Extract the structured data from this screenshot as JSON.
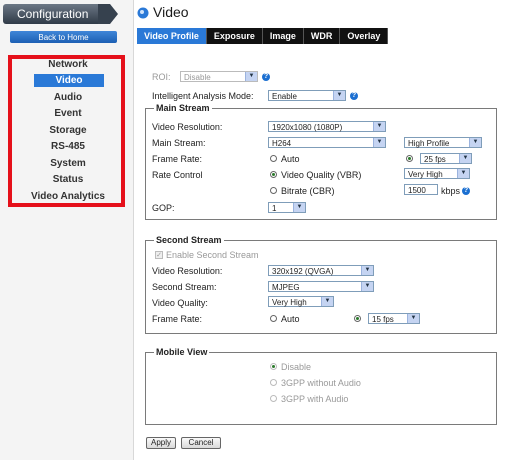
{
  "sidebar": {
    "config_label": "Configuration",
    "back_label": "Back to Home",
    "items": [
      "Network",
      "Video",
      "Audio",
      "Event",
      "Storage",
      "RS-485",
      "System",
      "Status",
      "Video Analytics"
    ],
    "active": "Video"
  },
  "header": {
    "title": "Video"
  },
  "tabs": [
    "Video Profile",
    "Exposure",
    "Image",
    "WDR",
    "Overlay"
  ],
  "form": {
    "roi_label": "ROI:",
    "roi_value": "Disable",
    "iam_label": "Intelligent Analysis Mode:",
    "iam_value": "Enable",
    "main": {
      "legend": "Main Stream",
      "resolution_label": "Video Resolution:",
      "resolution_value": "1920x1080 (1080P)",
      "stream_label": "Main Stream:",
      "stream_value": "H264",
      "profile_value": "High Profile",
      "framerate_label": "Frame Rate:",
      "auto_label": "Auto",
      "fps_value": "25 fps",
      "ratecontrol_label": "Rate Control",
      "vq_label": "Video Quality (VBR)",
      "vq_value": "Very High",
      "bitrate_label": "Bitrate (CBR)",
      "bitrate_value": "1500",
      "kbps_label": "kbps",
      "gop_label": "GOP:",
      "gop_value": "1"
    },
    "second": {
      "legend": "Second Stream",
      "enable_label": "Enable Second Stream",
      "resolution_label": "Video Resolution:",
      "resolution_value": "320x192 (QVGA)",
      "stream_label": "Second Stream:",
      "stream_value": "MJPEG",
      "quality_label": "Video Quality:",
      "quality_value": "Very High",
      "framerate_label": "Frame Rate:",
      "auto_label": "Auto",
      "fps_value": "15 fps"
    },
    "mobile": {
      "legend": "Mobile View",
      "options": [
        "Disable",
        "3GPP without Audio",
        "3GPP with Audio"
      ]
    },
    "apply_label": "Apply",
    "cancel_label": "Cancel"
  },
  "colors": {
    "highlight_box": "#e5101a",
    "active_blue": "#2a79d7"
  }
}
